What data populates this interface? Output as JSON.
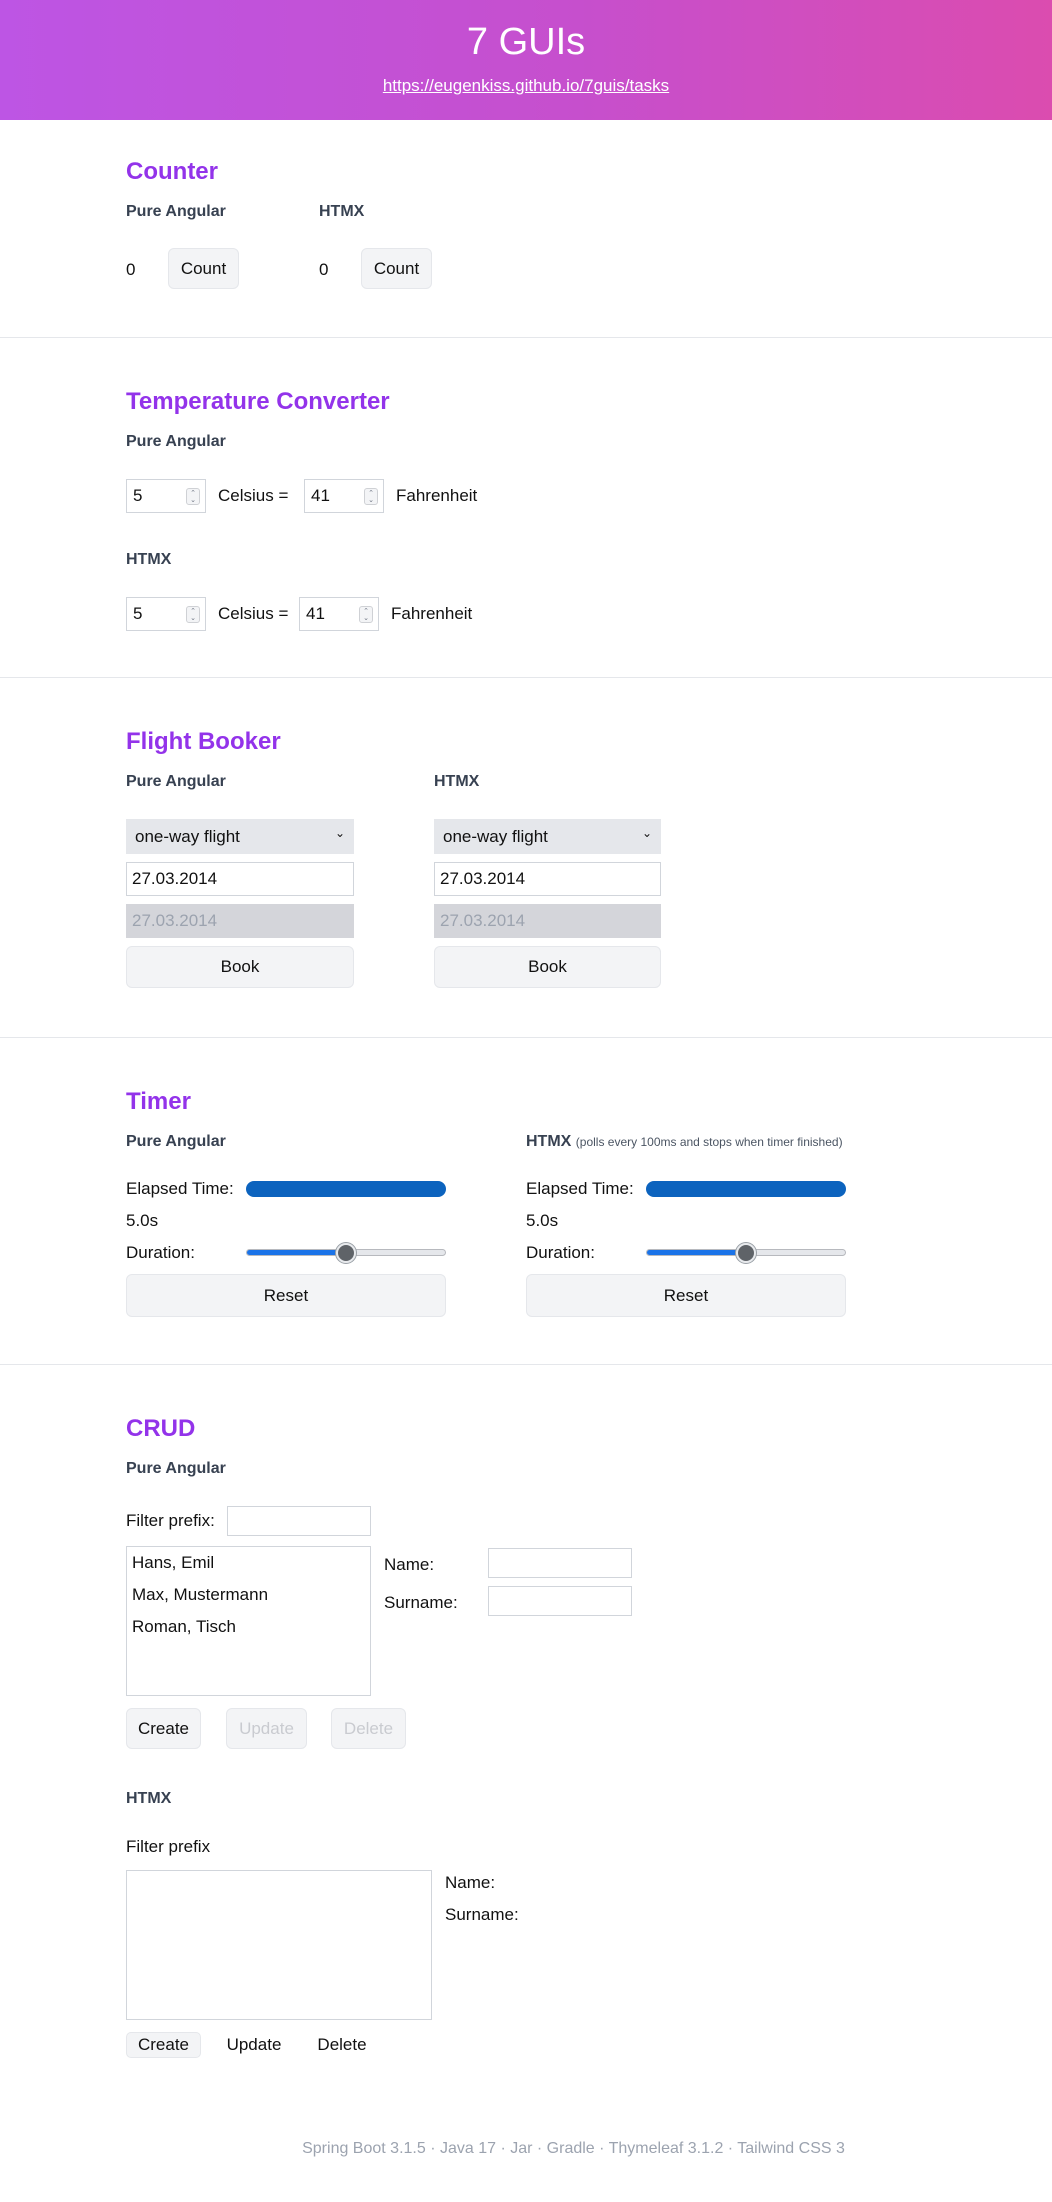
{
  "header": {
    "title": "7 GUIs",
    "link": "https://eugenkiss.github.io/7guis/tasks"
  },
  "counter": {
    "title": "Counter",
    "angular": {
      "label": "Pure Angular",
      "value": "0",
      "button": "Count"
    },
    "htmx": {
      "label": "HTMX",
      "value": "0",
      "button": "Count"
    }
  },
  "temperature": {
    "title": "Temperature Converter",
    "angular": {
      "label": "Pure Angular",
      "celsius": "5",
      "celsius_label": "Celsius =",
      "fahrenheit": "41",
      "fahrenheit_label": "Fahrenheit"
    },
    "htmx": {
      "label": "HTMX",
      "celsius": "5",
      "celsius_label": "Celsius =",
      "fahrenheit": "41",
      "fahrenheit_label": "Fahrenheit"
    }
  },
  "flight": {
    "title": "Flight Booker",
    "angular": {
      "label": "Pure Angular",
      "flight_type": "one-way flight",
      "start_date": "27.03.2014",
      "return_date": "27.03.2014",
      "button": "Book"
    },
    "htmx": {
      "label": "HTMX",
      "flight_type": "one-way flight",
      "start_date": "27.03.2014",
      "return_date": "27.03.2014",
      "button": "Book"
    }
  },
  "timer": {
    "title": "Timer",
    "angular": {
      "label": "Pure Angular",
      "elapsed_label": "Elapsed Time:",
      "progress": 1.0,
      "elapsed_value": "5.0s",
      "duration_label": "Duration:",
      "duration_fraction": 0.5,
      "button": "Reset"
    },
    "htmx": {
      "label": "HTMX",
      "note": "(polls every 100ms and stops when timer finished)",
      "elapsed_label": "Elapsed Time:",
      "progress": 1.0,
      "elapsed_value": "5.0s",
      "duration_label": "Duration:",
      "duration_fraction": 0.5,
      "button": "Reset"
    }
  },
  "crud": {
    "title": "CRUD",
    "angular": {
      "label": "Pure Angular",
      "filter_label": "Filter prefix:",
      "filter_value": "",
      "entries": [
        "Hans, Emil",
        "Max, Mustermann",
        "Roman, Tisch"
      ],
      "name_label": "Name:",
      "surname_label": "Surname:",
      "create": "Create",
      "update": "Update",
      "delete": "Delete"
    },
    "htmx": {
      "label": "HTMX",
      "filter_label": "Filter prefix",
      "name_label": "Name:",
      "surname_label": "Surname:",
      "create": "Create",
      "update": "Update",
      "delete": "Delete"
    }
  },
  "footer": {
    "text": "Spring Boot 3.1.5 · Java 17 · Jar · Gradle · Thymeleaf 3.1.2 · Tailwind CSS 3"
  },
  "colors": {
    "accent": "#9333ea",
    "header_gradient_start": "#bd55e4",
    "header_gradient_end": "#db4caf",
    "progress": "#0c63be"
  }
}
